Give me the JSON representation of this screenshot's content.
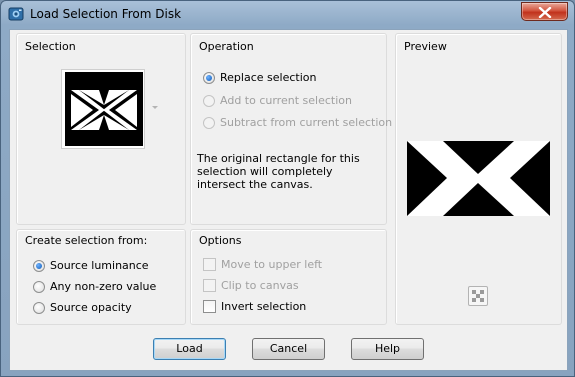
{
  "window": {
    "title": "Load Selection From Disk",
    "icon": "paintshop-pro-icon",
    "close_icon": "close-x-icon"
  },
  "selection_group": {
    "title": "Selection",
    "thumbnail_icon": "selection-thumbnail",
    "dropdown_icon": "chevron-down-icon"
  },
  "operation_group": {
    "title": "Operation",
    "options": [
      {
        "label": "Replace selection",
        "checked": true,
        "enabled": true
      },
      {
        "label": "Add to current selection",
        "checked": false,
        "enabled": false
      },
      {
        "label": "Subtract from current selection",
        "checked": false,
        "enabled": false
      }
    ],
    "description": "The original rectangle for this selection will completely intersect the canvas."
  },
  "preview_group": {
    "title": "Preview",
    "background_icon": "transparency-checker-icon"
  },
  "create_group": {
    "title": "Create selection from:",
    "options": [
      {
        "label": "Source luminance",
        "checked": true,
        "enabled": true
      },
      {
        "label": "Any non-zero value",
        "checked": false,
        "enabled": true
      },
      {
        "label": "Source opacity",
        "checked": false,
        "enabled": true
      }
    ]
  },
  "options_group": {
    "title": "Options",
    "checkboxes": [
      {
        "label": "Move to upper left",
        "checked": false,
        "enabled": false
      },
      {
        "label": "Clip to canvas",
        "checked": false,
        "enabled": false
      },
      {
        "label": "Invert selection",
        "checked": false,
        "enabled": true
      }
    ]
  },
  "buttons": {
    "load": "Load",
    "cancel": "Cancel",
    "help": "Help"
  }
}
